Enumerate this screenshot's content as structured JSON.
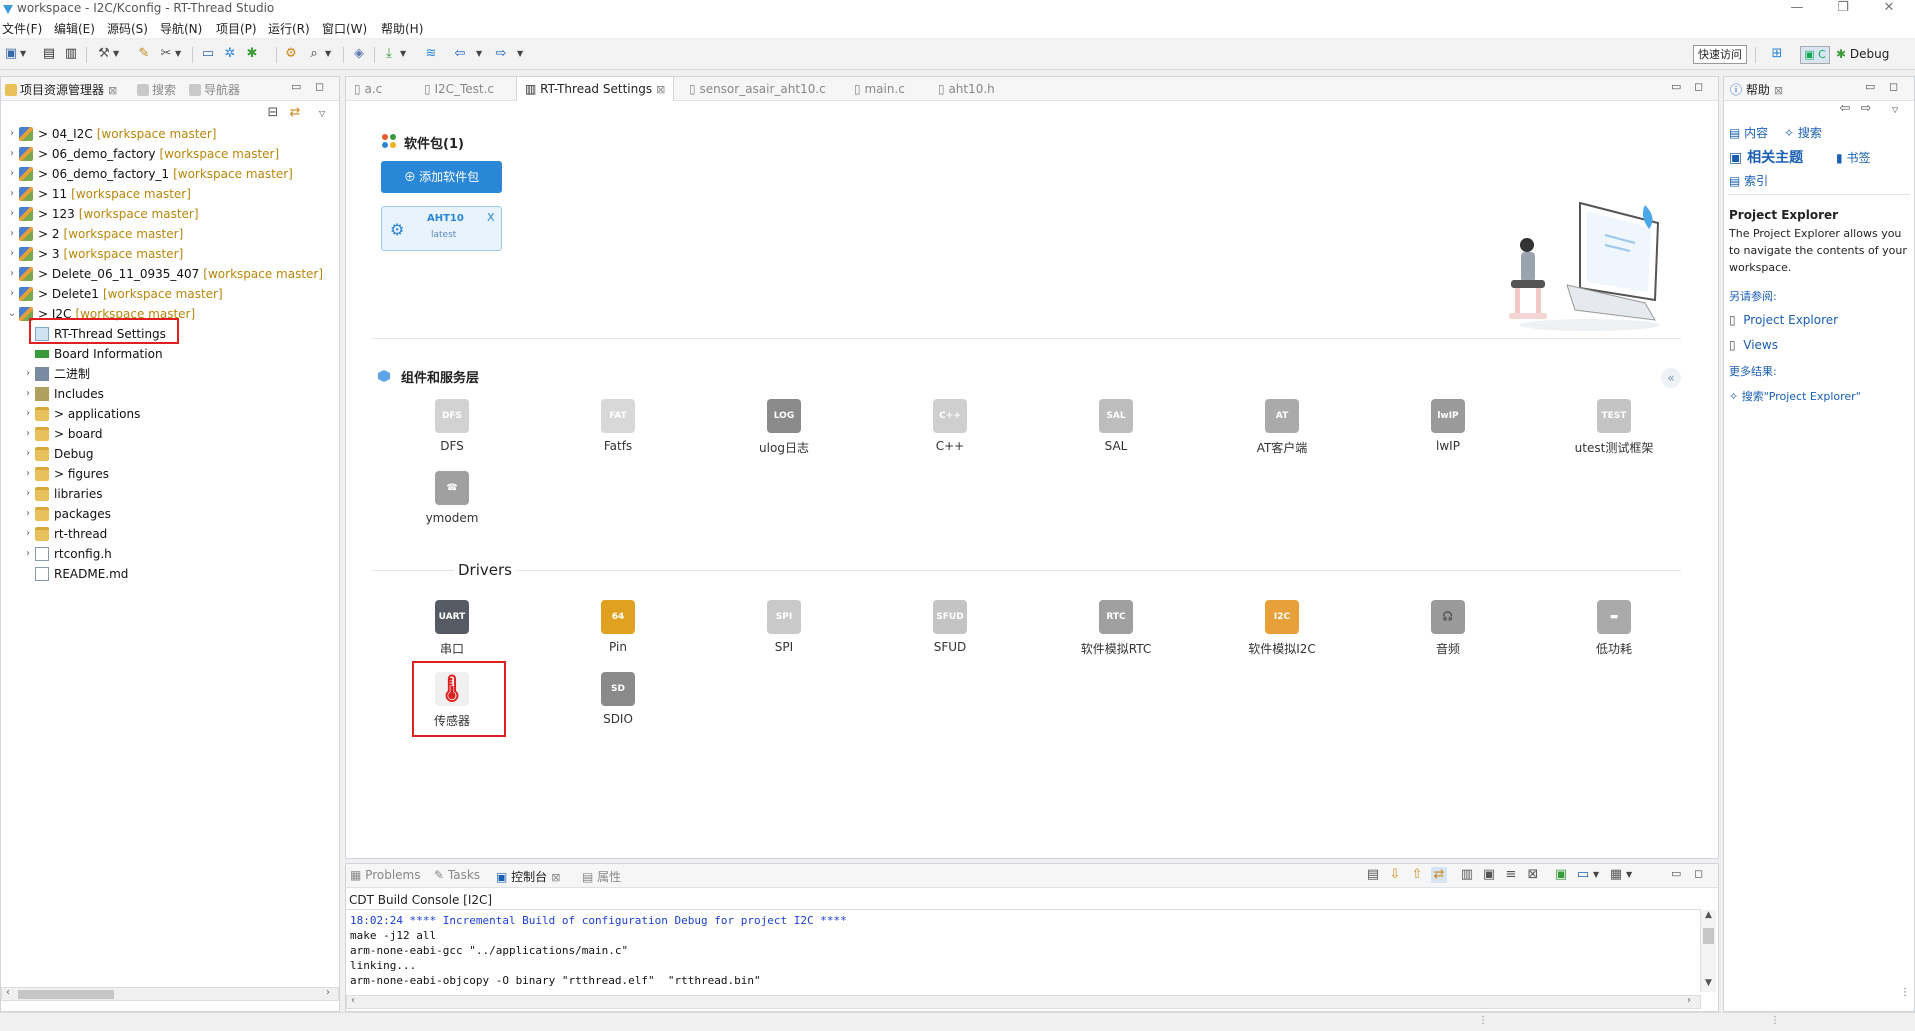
{
  "window": {
    "title": "workspace - I2C/Kconfig - RT-Thread Studio",
    "controls": [
      "—",
      "❐",
      "✕"
    ]
  },
  "menubar": [
    "文件(F)",
    "编辑(E)",
    "源码(S)",
    "导航(N)",
    "项目(P)",
    "运行(R)",
    "窗口(W)",
    "帮助(H)"
  ],
  "toolbar": {
    "quick_access": "快速访问",
    "perspective_c": "C",
    "perspective_debug": "Debug"
  },
  "left_panel": {
    "tabs": [
      {
        "label": "项目资源管理器",
        "active": true
      },
      {
        "label": "搜索",
        "active": false
      },
      {
        "label": "导航器",
        "active": false
      }
    ],
    "tree": [
      {
        "twisty": "›",
        "prefix": "> ",
        "label": "04_I2C",
        "deco": "[workspace master]",
        "icon": "project-icon",
        "level": 0
      },
      {
        "twisty": "›",
        "prefix": "> ",
        "label": "06_demo_factory",
        "deco": "[workspace master]",
        "icon": "project-icon",
        "level": 0
      },
      {
        "twisty": "›",
        "prefix": "> ",
        "label": "06_demo_factory_1",
        "deco": "[workspace master]",
        "icon": "project-icon",
        "level": 0
      },
      {
        "twisty": "›",
        "prefix": "> ",
        "label": "11",
        "deco": "[workspace master]",
        "icon": "project-icon",
        "level": 0
      },
      {
        "twisty": "›",
        "prefix": "> ",
        "label": "123",
        "deco": "[workspace master]",
        "icon": "project-icon",
        "level": 0
      },
      {
        "twisty": "›",
        "prefix": "> ",
        "label": "2",
        "deco": "[workspace master]",
        "icon": "project-icon",
        "level": 0
      },
      {
        "twisty": "›",
        "prefix": "> ",
        "label": "3",
        "deco": "[workspace master]",
        "icon": "project-icon",
        "level": 0
      },
      {
        "twisty": "›",
        "prefix": "> ",
        "label": "Delete_06_11_0935_407",
        "deco": "[workspace master]",
        "icon": "project-icon",
        "level": 0
      },
      {
        "twisty": "›",
        "prefix": "> ",
        "label": "Delete1",
        "deco": "[workspace master]",
        "icon": "project-icon",
        "level": 0
      },
      {
        "twisty": "⌄",
        "prefix": "> ",
        "label": "I2C",
        "deco": "[workspace master]",
        "icon": "project-icon",
        "level": 0
      },
      {
        "twisty": "",
        "prefix": "",
        "label": "RT-Thread Settings",
        "deco": "",
        "icon": "rt-settings-icon",
        "level": 1
      },
      {
        "twisty": "",
        "prefix": "",
        "label": "Board Information",
        "deco": "",
        "icon": "board-info-icon",
        "level": 1
      },
      {
        "twisty": "›",
        "prefix": "",
        "label": "二进制",
        "deco": "",
        "icon": "binaries-icon",
        "level": 1
      },
      {
        "twisty": "›",
        "prefix": "",
        "label": "Includes",
        "deco": "",
        "icon": "includes-icon",
        "level": 1
      },
      {
        "twisty": "›",
        "prefix": "> ",
        "label": "applications",
        "deco": "",
        "icon": "folder-icon",
        "level": 1
      },
      {
        "twisty": "›",
        "prefix": "> ",
        "label": "board",
        "deco": "",
        "icon": "folder-icon",
        "level": 1
      },
      {
        "twisty": "›",
        "prefix": "",
        "label": "Debug",
        "deco": "",
        "icon": "folder-icon",
        "level": 1
      },
      {
        "twisty": "›",
        "prefix": "> ",
        "label": "figures",
        "deco": "",
        "icon": "folder-icon",
        "level": 1
      },
      {
        "twisty": "›",
        "prefix": "",
        "label": "libraries",
        "deco": "",
        "icon": "folder-icon",
        "level": 1
      },
      {
        "twisty": "›",
        "prefix": "",
        "label": "packages",
        "deco": "",
        "icon": "folder-icon",
        "level": 1
      },
      {
        "twisty": "›",
        "prefix": "",
        "label": "rt-thread",
        "deco": "",
        "icon": "folder-icon",
        "level": 1
      },
      {
        "twisty": "›",
        "prefix": "",
        "label": "rtconfig.h",
        "deco": "",
        "icon": "header-file-icon",
        "level": 1
      },
      {
        "twisty": "",
        "prefix": "",
        "label": "README.md",
        "deco": "",
        "icon": "file-icon",
        "level": 1
      }
    ]
  },
  "editor": {
    "tabs": [
      {
        "label": "a.c",
        "active": false
      },
      {
        "label": "I2C_Test.c",
        "active": false
      },
      {
        "label": "RT-Thread Settings",
        "active": true
      },
      {
        "label": "sensor_asair_aht10.c",
        "active": false
      },
      {
        "label": "main.c",
        "active": false
      },
      {
        "label": "aht10.h",
        "active": false
      }
    ],
    "packages_title": "软件包(1)",
    "add_package_label": "添加软件包",
    "package_card": {
      "name": "AHT10",
      "version": "latest",
      "close": "X"
    },
    "components_title": "组件和服务层",
    "components": [
      {
        "label": "DFS",
        "icon": "DFS"
      },
      {
        "label": "Fatfs",
        "icon": "FAT"
      },
      {
        "label": "ulog日志",
        "icon": "LOG"
      },
      {
        "label": "C++",
        "icon": "C++"
      },
      {
        "label": "SAL",
        "icon": "SAL"
      },
      {
        "label": "AT客户端",
        "icon": "AT"
      },
      {
        "label": "lwIP",
        "icon": "lwIP"
      },
      {
        "label": "utest测试框架",
        "icon": "TEST"
      },
      {
        "label": "ymodem",
        "icon": "☎"
      }
    ],
    "drivers_title": "Drivers",
    "drivers": [
      {
        "label": "串口",
        "icon": "UART"
      },
      {
        "label": "Pin",
        "icon": "64"
      },
      {
        "label": "SPI",
        "icon": "SPI"
      },
      {
        "label": "SFUD",
        "icon": "SFUD"
      },
      {
        "label": "软件模拟RTC",
        "icon": "RTC"
      },
      {
        "label": "软件模拟I2C",
        "icon": "I2C"
      },
      {
        "label": "音频",
        "icon": "🎧"
      },
      {
        "label": "低功耗",
        "icon": "▬"
      },
      {
        "label": "传感器",
        "icon": "🌡"
      },
      {
        "label": "SDIO",
        "icon": "SD"
      }
    ],
    "collapse_label": "«",
    "colors": {
      "accent": "#2a86d6",
      "highlight": "#e02020"
    }
  },
  "help_panel": {
    "tab": "帮助",
    "links_top": [
      "内容",
      "搜索",
      "相关主题",
      "书签",
      "索引"
    ],
    "heading": "Project Explorer",
    "description": "The Project Explorer allows you to navigate the contents of your workspace.",
    "see_also": "另请参阅:",
    "see_links": [
      "Project Explorer",
      "Views"
    ],
    "more_results": "更多结果:",
    "search_link": "搜索\"Project Explorer\""
  },
  "console_panel": {
    "tabs": [
      {
        "label": "Problems",
        "active": false
      },
      {
        "label": "Tasks",
        "active": false
      },
      {
        "label": "控制台",
        "active": true
      },
      {
        "label": "属性",
        "active": false
      }
    ],
    "title": "CDT Build Console [I2C]",
    "lines": [
      {
        "text": "18:02:24 **** Incremental Build of configuration Debug for project I2C ****",
        "color": "#1a3fd6"
      },
      {
        "text": "make -j12 all",
        "color": "#111"
      },
      {
        "text": "arm-none-eabi-gcc \"../applications/main.c\"",
        "color": "#111"
      },
      {
        "text": "linking...",
        "color": "#111"
      },
      {
        "text": "arm-none-eabi-objcopy -O binary \"rtthread.elf\"  \"rtthread.bin\"",
        "color": "#111"
      }
    ]
  }
}
